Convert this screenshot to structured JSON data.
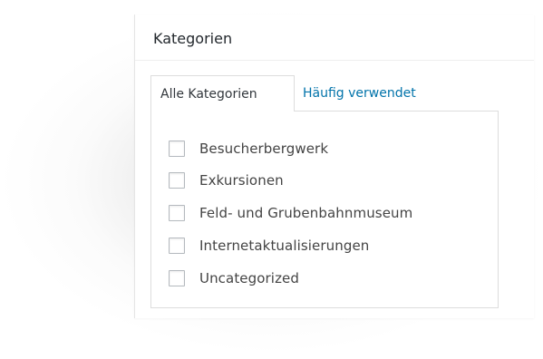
{
  "metabox": {
    "title": "Kategorien"
  },
  "tabs": [
    {
      "label": "Alle Kategorien",
      "active": true
    },
    {
      "label": "Häufig verwendet",
      "active": false
    }
  ],
  "categories": [
    {
      "label": "Besucherbergwerk",
      "checked": false
    },
    {
      "label": "Exkursionen",
      "checked": false
    },
    {
      "label": "Feld- und Grubenbahnmuseum",
      "checked": false
    },
    {
      "label": "Internetaktualisierungen",
      "checked": false
    },
    {
      "label": "Uncategorized",
      "checked": false
    }
  ],
  "colors": {
    "link": "#0073aa",
    "text": "#444444",
    "border": "#dddddd"
  }
}
